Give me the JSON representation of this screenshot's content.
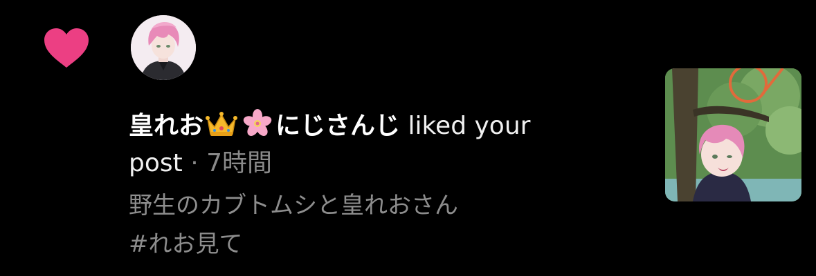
{
  "notification": {
    "type_icon": "heart-icon",
    "type_icon_color": "#ec3f83",
    "avatar_icon": "user-avatar",
    "username": "皇れお",
    "emoji_1": "crown-emoji",
    "emoji_2": "cherry-blossom-emoji",
    "username_suffix": "にじさんじ",
    "action_text": "liked your",
    "action_text_2": "post",
    "separator": "·",
    "time": "7時間",
    "snippet_line_1": "野生のカブトムシと皇れおさん",
    "snippet_line_2": "#れお見て",
    "thumbnail": "post-thumbnail"
  },
  "colors": {
    "background": "#000000",
    "primary_text": "#ffffff",
    "secondary_text": "#8a8a8a",
    "heart": "#ec3f83"
  }
}
